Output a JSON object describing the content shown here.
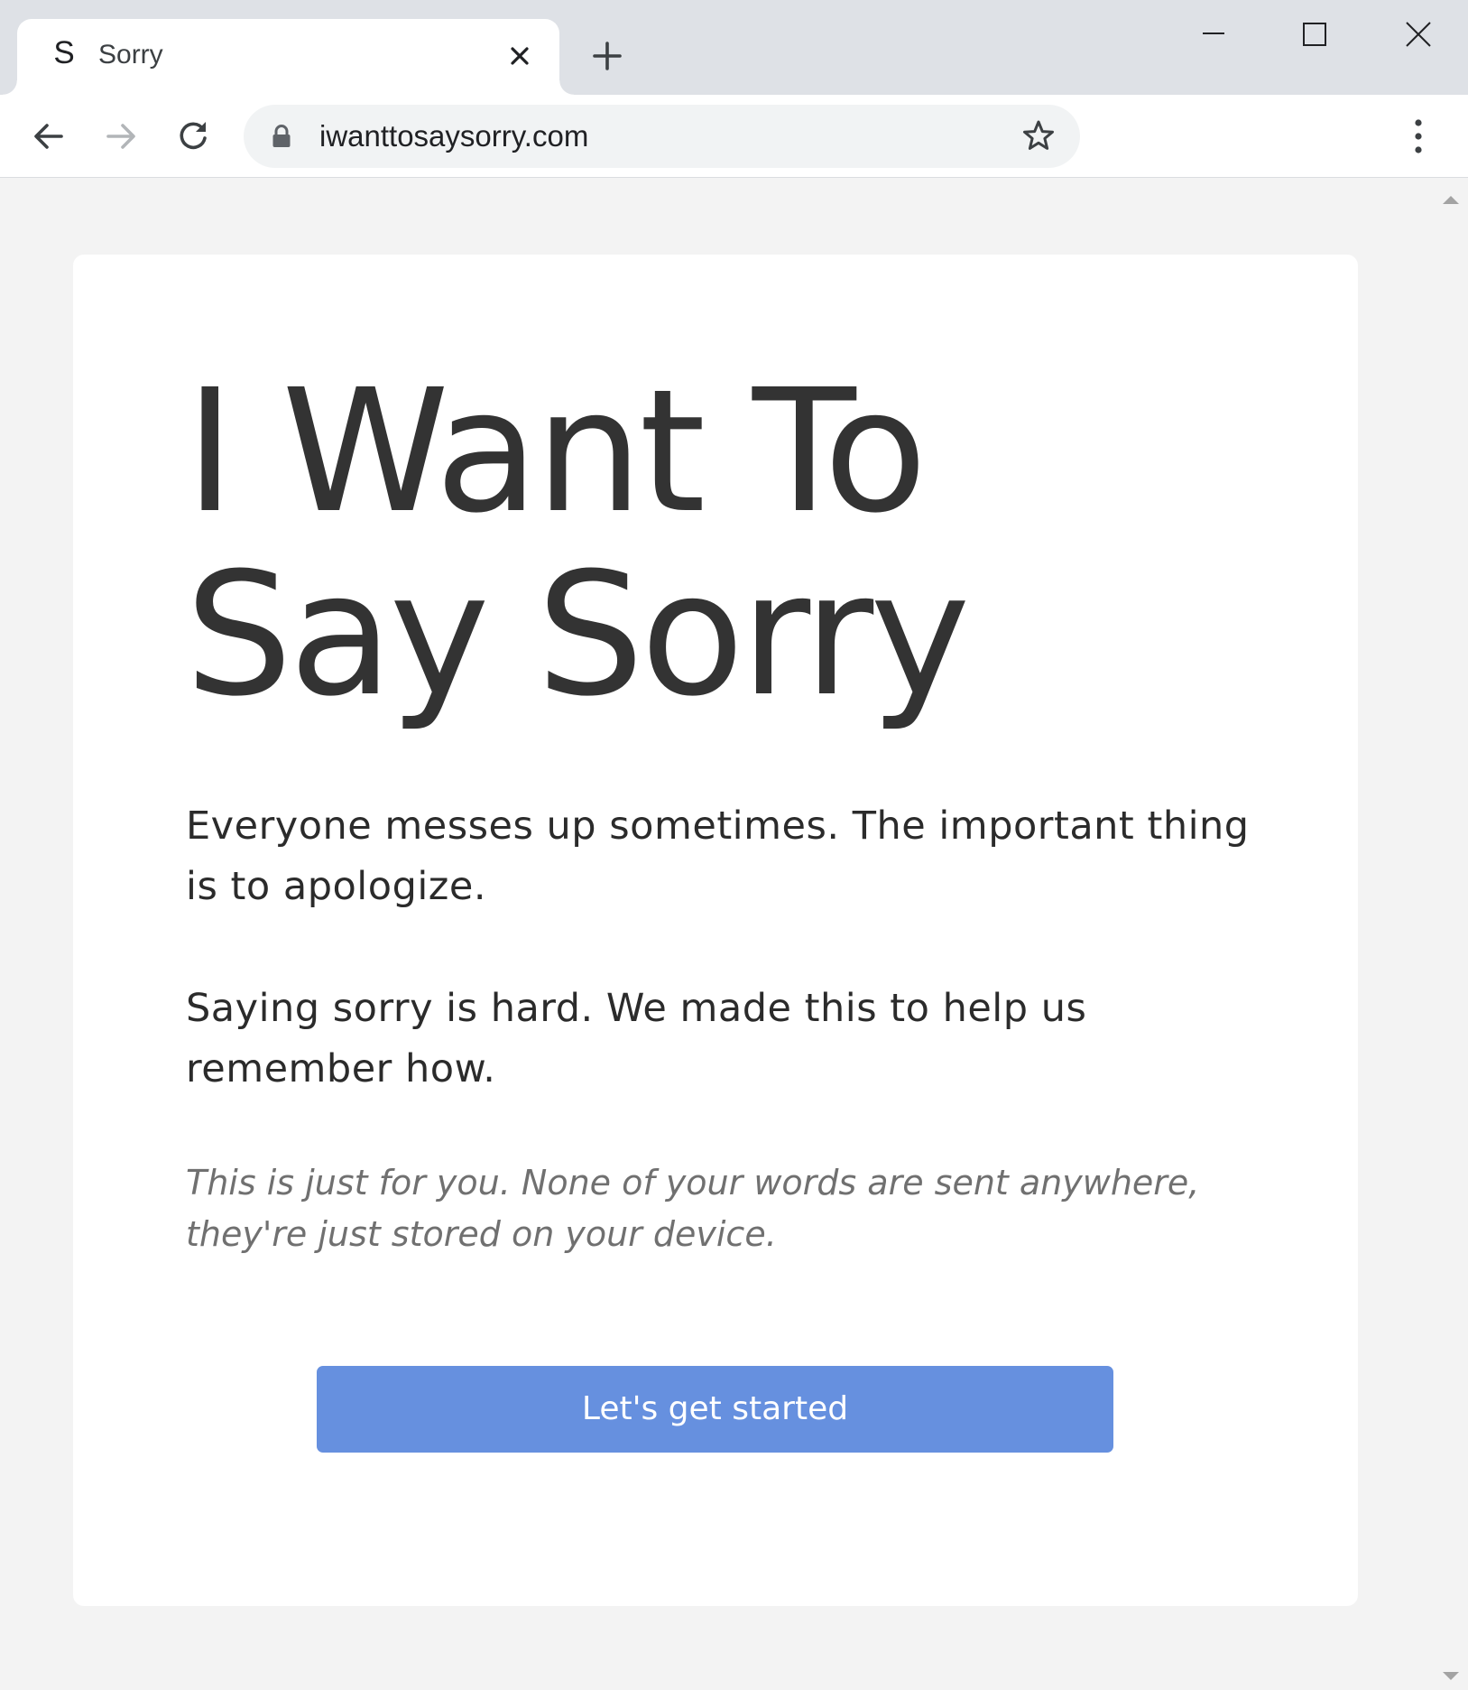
{
  "browser": {
    "tab": {
      "favicon_letter": "S",
      "title": "Sorry"
    },
    "address_bar": {
      "url": "iwanttosaysorry.com"
    },
    "icons": {
      "tab_close": "close-icon",
      "new_tab": "plus-icon",
      "minimize": "minimize-icon",
      "maximize": "maximize-icon",
      "window_close": "close-icon",
      "back": "arrow-left-icon",
      "forward": "arrow-right-icon",
      "reload": "reload-icon",
      "secure": "lock-icon",
      "bookmark": "star-icon",
      "menu": "kebab-menu-icon"
    }
  },
  "page": {
    "headline_line1": "I Want To",
    "headline_line2": "Say Sorry",
    "paragraph1": "Everyone messes up sometimes. The important thing is to apologize.",
    "paragraph2": "Saying sorry is hard. We made this to help us remember how.",
    "privacy_note": "This is just for you. None of your words are sent anywhere, they're just stored on your device.",
    "cta_label": "Let's get started"
  },
  "colors": {
    "page_background": "#f3f3f3",
    "card_background": "#ffffff",
    "text": "#333333",
    "note_text": "#707070",
    "button": "#6690df",
    "button_text": "#ffffff"
  }
}
